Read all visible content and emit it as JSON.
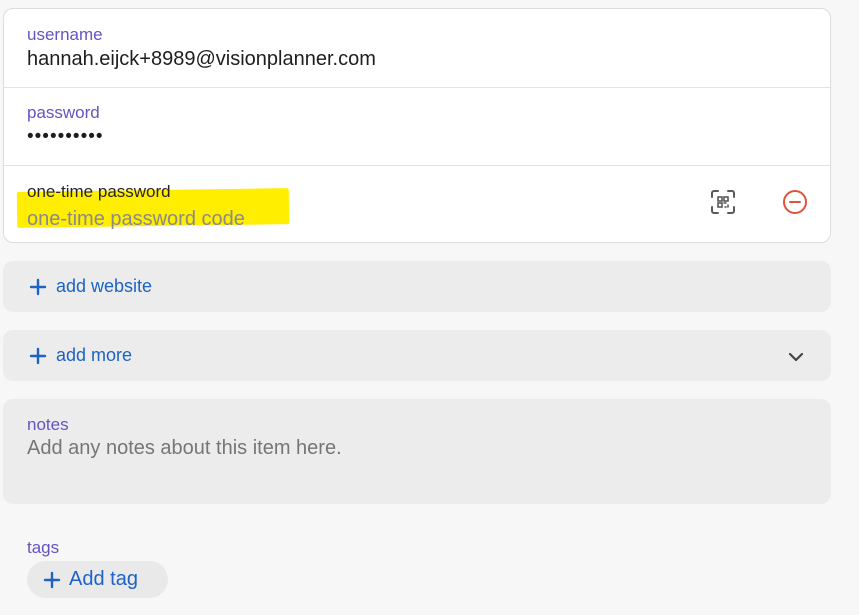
{
  "credentials": {
    "username": {
      "label": "username",
      "value": "hannah.eijck+8989@visionplanner.com"
    },
    "password": {
      "label": "password",
      "value": "••••••••••"
    },
    "otp": {
      "label": "one-time password",
      "placeholder": "one-time password code",
      "scan_icon": "qr-scan-icon",
      "remove_icon": "remove-circle-icon",
      "highlight_color": "#ffee00"
    }
  },
  "add_website": {
    "label": "add website",
    "icon": "plus-icon"
  },
  "add_more": {
    "label": "add more",
    "icon": "plus-icon",
    "expand_icon": "chevron-down-icon"
  },
  "notes": {
    "label": "notes",
    "placeholder": "Add any notes about this item here."
  },
  "tags": {
    "label": "tags",
    "add_label": "Add tag",
    "icon": "plus-icon"
  },
  "colors": {
    "label_purple": "#6554c0",
    "link_blue": "#1d62c4",
    "remove_red": "#e2513b",
    "panel_gray": "#ececec"
  }
}
